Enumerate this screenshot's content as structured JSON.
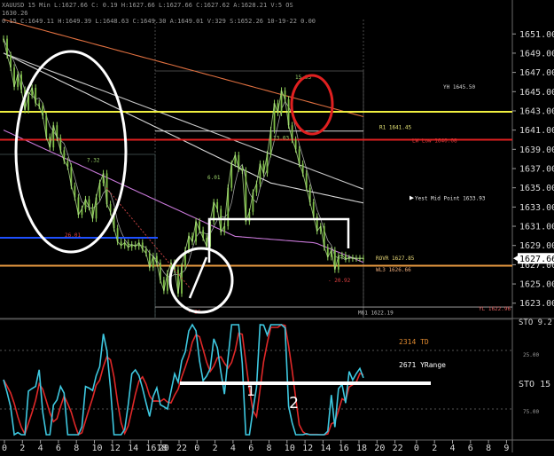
{
  "header": {
    "line1": "XAUUSD 15 Min  L:1627.66  C: 0.19  H:1627.66  L:1627.66  C:1627.62  A:1628.21  V:5  OS",
    "line2": "1630.26",
    "line3": "0.15  C:1649.11  H:1649.39  L:1648.63  C:1649.30  A:1649.01  V:329  S:1652.26  10-19-22  0.00"
  },
  "chart_data": [
    {
      "type": "line",
      "panel": "price",
      "title": "",
      "ylim": [
        1621.5,
        1652.5
      ],
      "y_ticks": [
        "1651.00",
        "1649.00",
        "1647.00",
        "1645.00",
        "1643.00",
        "1641.00",
        "1639.00",
        "1637.00",
        "1635.00",
        "1633.00",
        "1631.00",
        "1629.00",
        "1627.00",
        "1625.00",
        "1623.00"
      ],
      "current_price": "1627.66",
      "x": [
        0,
        1,
        2,
        3,
        4,
        5,
        6,
        7,
        8,
        9,
        10,
        11,
        12,
        13,
        14,
        15,
        16,
        17,
        18,
        19,
        20,
        21,
        22,
        23,
        24,
        25,
        26,
        27,
        28,
        29,
        30,
        31,
        32,
        33,
        34,
        35,
        36,
        37,
        38,
        39,
        40,
        41,
        42,
        43,
        44,
        45,
        46,
        47,
        48,
        49,
        50,
        51,
        52,
        53,
        54,
        55,
        56,
        57,
        58,
        59,
        60,
        61,
        62,
        63,
        64,
        65,
        66,
        67,
        68,
        69,
        70,
        71,
        72,
        73,
        74,
        75,
        76,
        77,
        78,
        79,
        80,
        81,
        82,
        83,
        84,
        85,
        86,
        87,
        88,
        89,
        90,
        91,
        92,
        93,
        94,
        95,
        96,
        97,
        98,
        99,
        100,
        101,
        102,
        103,
        104,
        105,
        106,
        107,
        108,
        109,
        110,
        111,
        112,
        113,
        114,
        115,
        116,
        117,
        118,
        119,
        120,
        121,
        122,
        123,
        124,
        125,
        126,
        127,
        128,
        129,
        130,
        131,
        132,
        133,
        134,
        135,
        136,
        137,
        138,
        139,
        140,
        141,
        142,
        143,
        144,
        145,
        146,
        147,
        148,
        149,
        150,
        151,
        152,
        153,
        154,
        155,
        156,
        157,
        158,
        159,
        160,
        161,
        162,
        163,
        164,
        165,
        166,
        167,
        168,
        169,
        170,
        171,
        172,
        173,
        174,
        175,
        176,
        177,
        178,
        179,
        180,
        181,
        182,
        183,
        184,
        185,
        186,
        187,
        188,
        189,
        190,
        191,
        192,
        193,
        194,
        195,
        196,
        197,
        198,
        199,
        200,
        201,
        202,
        203,
        204,
        205,
        206,
        207,
        208,
        209,
        210,
        211,
        212,
        213,
        214,
        215,
        216,
        217,
        218,
        219,
        220,
        221,
        222,
        223,
        224,
        225,
        226,
        227,
        228,
        229,
        230,
        231,
        232,
        233,
        234,
        235,
        236,
        237,
        238,
        239,
        240,
        241,
        242,
        243,
        244,
        245,
        246,
        247,
        248,
        249,
        250,
        251,
        252,
        253,
        254,
        255,
        256,
        257,
        258,
        259,
        260,
        261,
        262,
        263,
        264,
        265,
        266,
        267,
        268,
        269,
        270,
        271,
        272,
        273,
        274,
        275,
        276,
        277,
        278,
        279,
        280,
        281,
        282,
        283,
        284,
        285,
        286,
        287,
        288,
        289,
        290,
        291,
        292,
        293,
        294,
        295,
        296,
        297,
        298,
        299,
        300,
        301,
        302,
        303,
        304,
        305,
        306,
        307,
        308,
        309,
        310,
        311,
        312,
        313,
        314,
        315,
        316,
        317,
        318,
        319,
        320,
        321,
        322,
        323,
        324,
        325,
        326,
        327,
        328,
        329,
        330,
        331,
        332,
        333,
        334,
        335,
        336,
        337,
        338,
        339,
        340,
        341,
        342,
        343,
        344,
        345,
        346,
        347,
        348,
        349,
        350,
        351,
        352,
        353,
        354,
        355,
        356,
        357,
        358,
        359,
        360,
        361,
        362,
        363,
        364,
        365,
        366,
        367,
        368,
        369,
        370,
        371,
        372,
        373,
        374,
        375,
        376,
        377,
        378,
        379,
        380,
        381,
        382,
        383,
        384,
        385,
        386,
        387,
        388,
        389,
        390,
        391,
        392,
        393,
        394,
        395,
        396,
        397,
        398,
        399,
        400,
        401,
        402,
        403,
        404,
        405,
        406,
        407,
        408,
        409,
        410,
        411,
        412,
        413,
        414,
        415,
        416,
        417,
        418,
        419,
        420,
        421,
        422,
        423,
        424,
        425,
        426,
        427,
        428,
        429,
        430,
        431,
        432,
        433,
        434,
        435,
        436,
        437,
        438,
        439,
        440,
        441,
        442,
        443,
        444,
        445,
        446,
        447,
        448,
        449,
        450,
        451,
        452,
        453,
        454,
        455,
        456,
        457,
        458,
        459,
        460,
        461,
        462,
        463,
        464,
        465,
        466,
        467,
        468,
        469,
        470,
        471,
        472,
        473,
        474,
        475,
        476,
        477,
        478,
        479,
        480,
        481,
        482,
        483,
        484,
        485,
        486,
        487,
        488,
        489,
        490,
        491,
        492,
        493,
        494,
        495,
        496,
        497,
        498,
        499
      ],
      "series": [
        {
          "name": "price",
          "color": "#9bd36b",
          "x": [
            0,
            2,
            4,
            6,
            8,
            10,
            12,
            14,
            16,
            18,
            20,
            22,
            24,
            26,
            28,
            30,
            32,
            34,
            36,
            38,
            40,
            42,
            44,
            46,
            48,
            50,
            52,
            54,
            56,
            58,
            60,
            62,
            64,
            66,
            68,
            70,
            72,
            74,
            76,
            78,
            80,
            82,
            84,
            86,
            88,
            90,
            92,
            94,
            96,
            98,
            100,
            102,
            104,
            106,
            108,
            110,
            112,
            114,
            116,
            118,
            120,
            122,
            124,
            126,
            128,
            130,
            132,
            134,
            136,
            138,
            140,
            142,
            144,
            146,
            148,
            150,
            152,
            154,
            156,
            158,
            160,
            162,
            164,
            166,
            168,
            170,
            172,
            174,
            176,
            178,
            180,
            182,
            184,
            186,
            188,
            190,
            192,
            194,
            196,
            198,
            200,
            202
          ],
          "values": [
            1650.5,
            1648.8,
            1647.5,
            1645.5,
            1646.8,
            1645.2,
            1643.1,
            1644.6,
            1645.4,
            1643.8,
            1643.5,
            1642.5,
            1640.3,
            1639.2,
            1641.5,
            1640.2,
            1638.9,
            1637.8,
            1637.2,
            1635.2,
            1634.0,
            1632.2,
            1632.8,
            1633.8,
            1633.0,
            1631.8,
            1634.0,
            1635.5,
            1636.5,
            1633.3,
            1632.5,
            1630.8,
            1629.4,
            1629.0,
            1629.3,
            1628.8,
            1629.1,
            1628.9,
            1629.3,
            1628.6,
            1628.2,
            1626.7,
            1627.9,
            1627.2,
            1625.4,
            1624.3,
            1626.1,
            1627.2,
            1626.5,
            1624.0,
            1626.8,
            1628.5,
            1630.0,
            1629.4,
            1631.5,
            1630.6,
            1629.8,
            1628.9,
            1631.5,
            1633.5,
            1632.8,
            1630.4,
            1631.0,
            1635.0,
            1637.5,
            1638.4,
            1637.0,
            1636.8,
            1631.5,
            1632.5,
            1634.5,
            1635.4,
            1637.5,
            1636.5,
            1638.5,
            1641.0,
            1643.8,
            1642.8,
            1645.1,
            1644.2,
            1641.5,
            1640.0,
            1639.0,
            1637.5,
            1636.5,
            1635.0,
            1633.5,
            1632.0,
            1630.5,
            1631.0,
            1628.8,
            1627.8,
            1628.5,
            1626.5,
            1627.9,
            1628.0,
            1627.6,
            1627.7,
            1627.66,
            1627.66,
            1627.66,
            1627.66
          ]
        }
      ],
      "levels": [
        {
          "label": "YH 1645.50",
          "value": 1645.5,
          "color": "#cfcfcf"
        },
        {
          "label": "R1 1641.45",
          "value": 1641.45,
          "color": "#e8e878"
        },
        {
          "label": "LW Low 1640.08",
          "value": 1640.08,
          "color": "#e03a3a"
        },
        {
          "label": "Yest Mid Point 1633.93",
          "value": 1633.93,
          "color": "#e0e0e0"
        },
        {
          "label": "ROVR 1627.85",
          "value": 1627.85,
          "color": "#e8d878"
        },
        {
          "label": "WL3 1626.66",
          "value": 1626.66,
          "color": "#e8a878"
        },
        {
          "label": "M61 1622.19",
          "value": 1622.19,
          "color": "#bdbdbd"
        },
        {
          "label": "YL 1622.96",
          "value": 1622.96,
          "color": "#e06060"
        }
      ],
      "annotations": [
        "7.32",
        "26.01",
        "6.01",
        "13.03",
        "15.93",
        "- 20.92",
        "- 26"
      ]
    },
    {
      "type": "line",
      "panel": "oscillator",
      "title": "",
      "y_ticks": [
        "25.00",
        "75.00"
      ],
      "labels": {
        "td": "2314 TD",
        "yrange": "2671 YRange",
        "sto": "STO  15",
        "sto_top": "STO  9.2"
      },
      "handwritten": [
        "1",
        "2"
      ]
    }
  ],
  "x_axis": {
    "ticks": [
      "0",
      "2",
      "4",
      "6",
      "8",
      "10",
      "12",
      "14",
      "1618",
      "20",
      "22",
      "0",
      "2",
      "4",
      "6",
      "8",
      "10",
      "12",
      "14",
      "16",
      "18",
      "20",
      "22",
      "0",
      "2",
      "4",
      "6",
      "8",
      "9"
    ]
  }
}
